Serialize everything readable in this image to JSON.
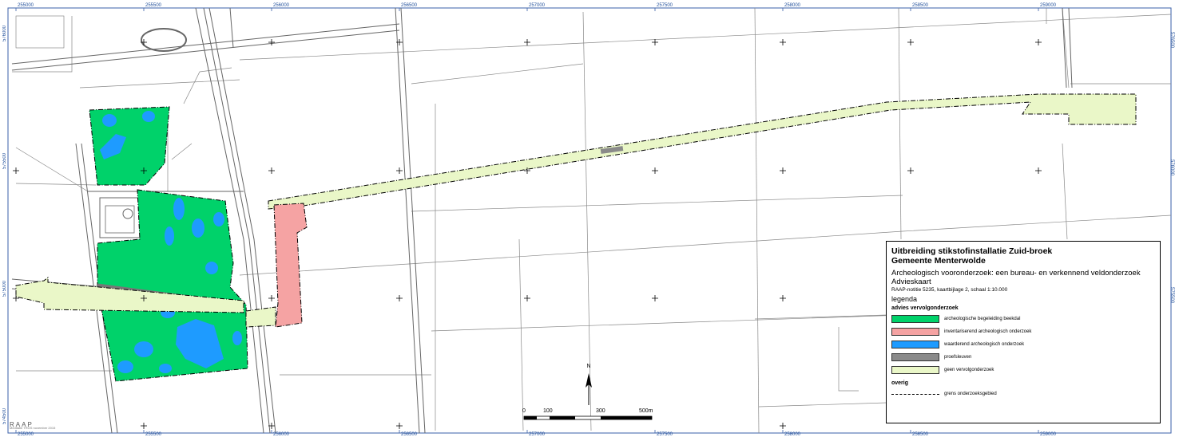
{
  "map": {
    "coords_top": [
      "255000",
      "255500",
      "256000",
      "256500",
      "257000",
      "257500",
      "258000",
      "258500",
      "259000"
    ],
    "coords_bottom": [
      "255000",
      "255500",
      "256000",
      "256500",
      "257000",
      "257500",
      "258000",
      "258500",
      "259000"
    ],
    "coords_left": [
      "576000",
      "575500",
      "575000",
      "574500"
    ],
    "coords_right": [
      "576500",
      "576000",
      "575500"
    ]
  },
  "legend": {
    "title_line1": "Uitbreiding stikstofinstallatie Zuid-broek",
    "title_line2": "Gemeente Menterwolde",
    "subtitle": "Archeologisch vooronderzoek: een bureau- en verkennend veldonderzoek",
    "map_type": "Advieskaart",
    "reference": "RAAP-notitie 5235, kaartbijlage 2, schaal 1:10.000",
    "heading": "legenda",
    "section1": "advies vervolgonderzoek",
    "items": [
      {
        "label": "archeologische begeleiding beekdal",
        "color": "#00d26a"
      },
      {
        "label": "inventariserend archeologisch onderzoek",
        "color": "#f5a3a3"
      },
      {
        "label": "waarderend archeologisch onderzoek",
        "color": "#1e9bff"
      },
      {
        "label": "proefsleuven",
        "color": "#8a8a8a"
      },
      {
        "label": "geen vervolgonderzoek",
        "color": "#eaf7c8"
      }
    ],
    "section2": "overig",
    "line_item": "grens onderzoeksgebied"
  },
  "scalebar": {
    "labels": [
      "0",
      "100",
      "300",
      "500m"
    ]
  },
  "north": "N",
  "logo": "RAAP",
  "credit": "Meditatie TRGS november 2015"
}
